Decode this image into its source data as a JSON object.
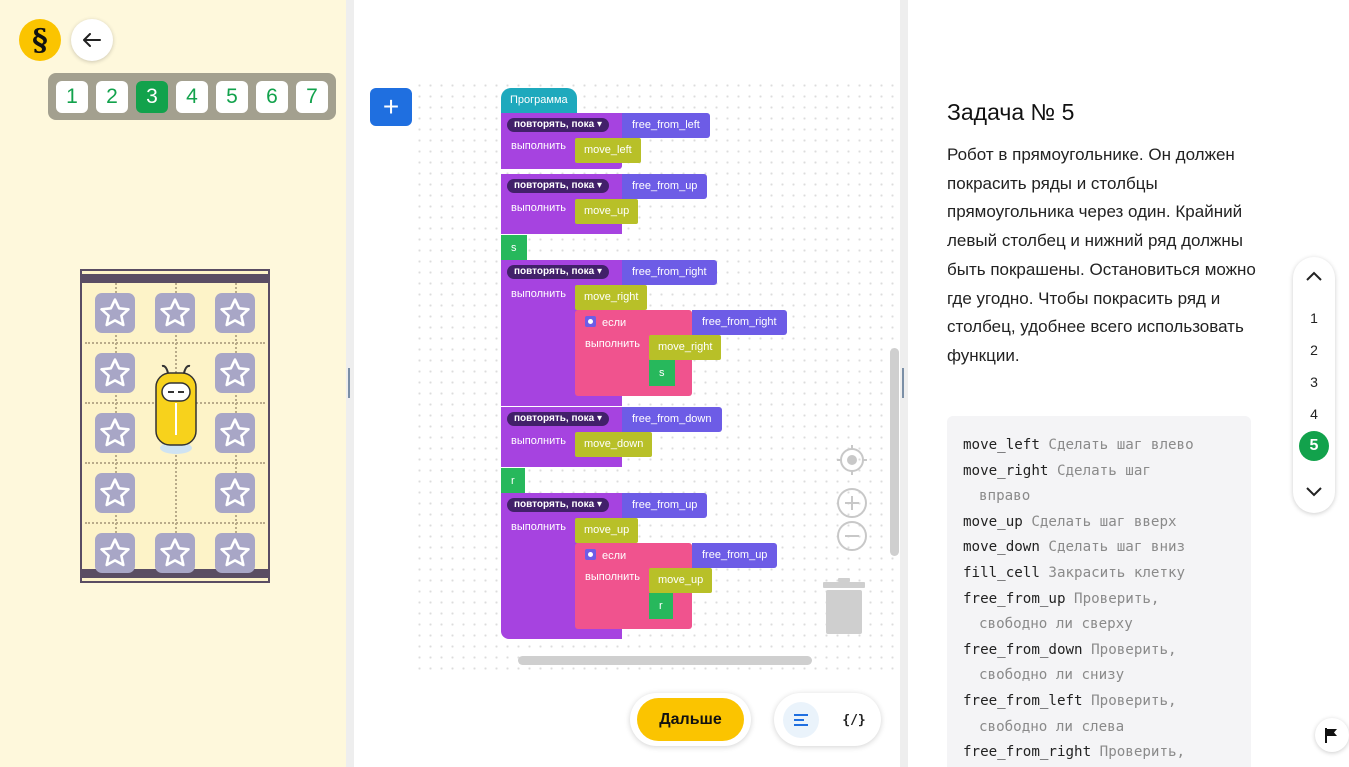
{
  "header": {
    "logo_glyph": "§",
    "back_icon": "arrow-left-icon"
  },
  "levels": [
    {
      "label": "1",
      "active": false
    },
    {
      "label": "2",
      "active": false
    },
    {
      "label": "3",
      "active": true
    },
    {
      "label": "4",
      "active": false
    },
    {
      "label": "5",
      "active": false
    },
    {
      "label": "6",
      "active": false
    },
    {
      "label": "7",
      "active": false
    }
  ],
  "colors": {
    "accent_green": "#12a24c",
    "yellow": "#fbc400",
    "panel_bg": "#fef8dc",
    "loop_block": "#a643e0",
    "condition_block": "#6d5ce6",
    "action_block": "#b8c028",
    "if_block": "#f0538e",
    "variable_block": "#27b85c",
    "program_block": "#1ea9bd"
  },
  "board": {
    "columns": 3,
    "rows": 5,
    "stars": [
      [
        true,
        true,
        true
      ],
      [
        true,
        false,
        true
      ],
      [
        true,
        false,
        true
      ],
      [
        true,
        false,
        true
      ],
      [
        true,
        true,
        true
      ]
    ],
    "robot_cell": {
      "row": 2,
      "col": 2
    }
  },
  "program": {
    "start": "Программа",
    "loop_label": "повторять, пока",
    "do_label": "выполнить",
    "if_label": "если",
    "loop1_cond": "free_from_left",
    "loop1_body": "move_left",
    "loop2_cond": "free_from_up",
    "loop2_body": "move_up",
    "call1": "s",
    "loop3_cond": "free_from_right",
    "loop3_body": "move_right",
    "if1_cond": "free_from_right",
    "if1_move": "move_right",
    "if1_call": "s",
    "loop4_cond": "free_from_down",
    "loop4_body": "move_down",
    "call2": "r",
    "loop5_cond": "free_from_up",
    "loop5_body": "move_up",
    "if2_cond": "free_from_up",
    "if2_move": "move_up",
    "if2_call": "r"
  },
  "buttons": {
    "next_label": "Дальше",
    "code_mode_label": "{/}"
  },
  "task": {
    "title": "Задача № 5",
    "description": "Робот в прямоугольнике. Он должен покрасить ряды и столбцы прямоугольника через один. Крайний левый столбец и нижний ряд должны быть покрашены. Остановиться можно где угодно. Чтобы покрасить ряд и столбец, удобнее всего использовать функции."
  },
  "api_lines": [
    {
      "name": "move_left",
      "desc": "Сделать шаг влево"
    },
    {
      "name": "move_right",
      "desc": "Сделать шаг"
    },
    {
      "cont": "вправо"
    },
    {
      "name": "move_up",
      "desc": "Сделать шаг вверх"
    },
    {
      "name": "move_down",
      "desc": "Сделать шаг вниз"
    },
    {
      "name": "fill_cell",
      "desc": "Закрасить клетку"
    },
    {
      "name": "free_from_up",
      "desc": "Проверить,"
    },
    {
      "cont": "свободно ли сверху"
    },
    {
      "name": "free_from_down",
      "desc": "Проверить,"
    },
    {
      "cont": "свободно ли снизу"
    },
    {
      "name": "free_from_left",
      "desc": "Проверить,"
    },
    {
      "cont": "свободно ли слева"
    },
    {
      "name": "free_from_right",
      "desc": "Проверить,"
    }
  ],
  "task_nav": {
    "items": [
      "1",
      "2",
      "3",
      "4",
      "5"
    ],
    "active": "5"
  }
}
